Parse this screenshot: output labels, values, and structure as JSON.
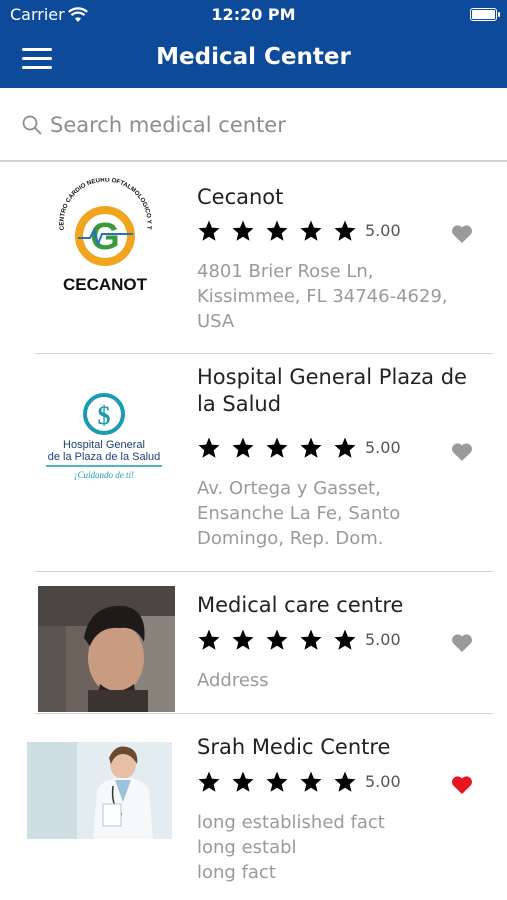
{
  "status_bar": {
    "carrier": "Carrier",
    "time": "12:20 PM"
  },
  "navbar": {
    "title": "Medical Center",
    "menu_icon": "hamburger-menu-icon"
  },
  "search": {
    "placeholder": "Search medical center",
    "value": ""
  },
  "colors": {
    "brand": "#0e4a9a",
    "favorite_on": "#e8141e",
    "favorite_off": "#9a9a9a"
  },
  "centers": [
    {
      "name": "Cecanot",
      "rating": "5.00",
      "stars": 5,
      "address": "4801 Brier Rose Ln,\nKissimmee, FL 34746-4629,\nUSA",
      "favorite": false,
      "logo_text": "CECANOT",
      "logo_ring_text": "CENTRO CARDIO NEURO OFTALMOLOGICO Y TRASPLANTE"
    },
    {
      "name": "Hospital General Plaza de la Salud",
      "rating": "5.00",
      "stars": 5,
      "address": "Av. Ortega y Gasset,\nEnsanche La Fe, Santo\nDomingo, Rep. Dom.",
      "favorite": false,
      "logo_text_1": "Hospital General",
      "logo_text_2": "de la Plaza de la Salud",
      "logo_tagline": "¡Cuidando de ti!"
    },
    {
      "name": "Medical care centre",
      "rating": "5.00",
      "stars": 5,
      "address": "Address",
      "favorite": false
    },
    {
      "name": "Srah Medic Centre",
      "rating": "5.00",
      "stars": 5,
      "address": "long established fact\nlong establ\nlong  fact",
      "favorite": true
    }
  ]
}
